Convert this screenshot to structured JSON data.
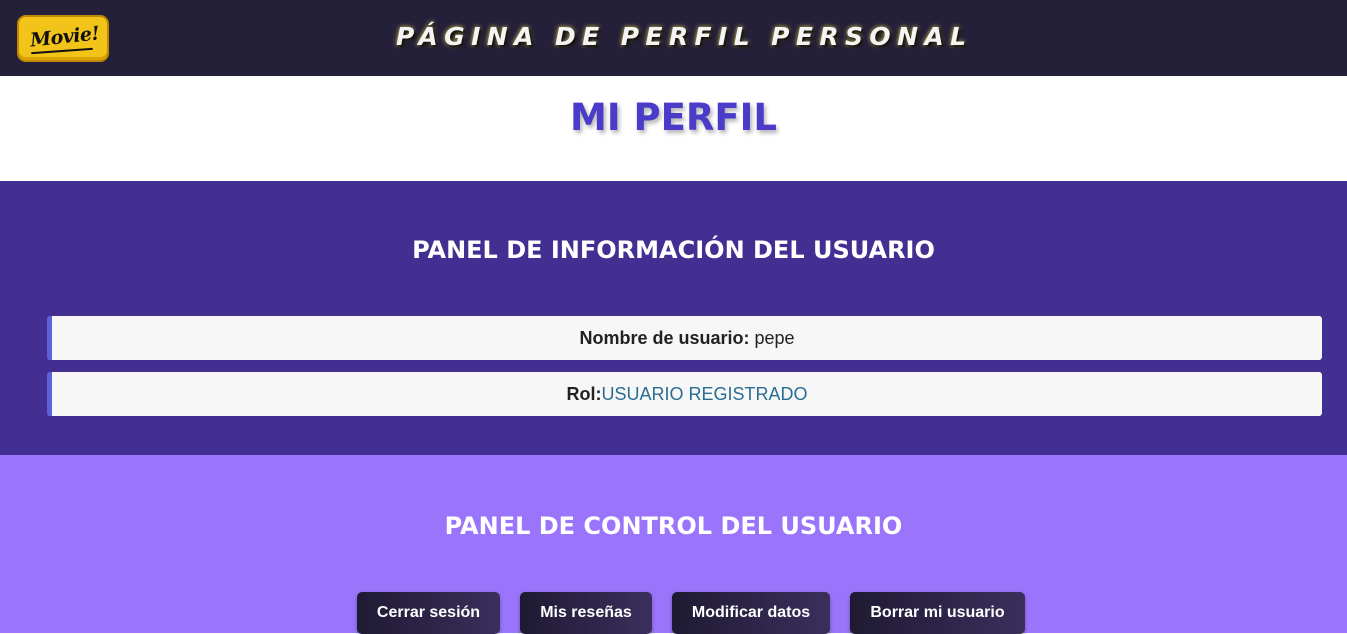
{
  "header": {
    "logo_text": "Movie!",
    "title": "PÁGINA DE PERFIL PERSONAL"
  },
  "main": {
    "title": "MI PERFIL"
  },
  "info_panel": {
    "title": "PANEL DE INFORMACIÓN DEL USUARIO",
    "username_label": "Nombre de usuario:",
    "username_value": "pepe",
    "role_label": "Rol:",
    "role_value": "USUARIO REGISTRADO"
  },
  "control_panel": {
    "title": "PANEL DE CONTROL DEL USUARIO",
    "buttons": {
      "logout": "Cerrar sesión",
      "reviews": "Mis reseñas",
      "modify": "Modificar datos",
      "delete": "Borrar mi usuario"
    }
  },
  "colors": {
    "header_bg": "#25203a",
    "logo_bg": "#f2c318",
    "title_color": "#4a3bc9",
    "info_panel_bg": "#432f92",
    "control_panel_bg": "#9a75fc",
    "role_value_color": "#2a6d92"
  }
}
